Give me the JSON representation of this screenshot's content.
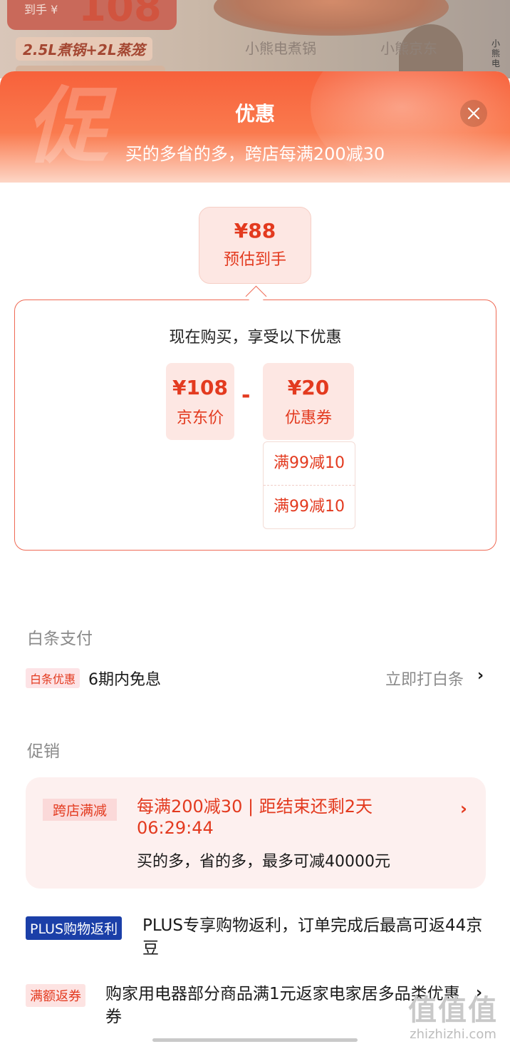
{
  "background_page": {
    "price_label": "到手 ¥",
    "price_value": "108",
    "feature": "2.5L煮锅+2L蒸笼",
    "tab_1": "小熊电煮锅",
    "tab_2": "小熊京东",
    "side_text": "小熊电"
  },
  "sheet": {
    "watermark_glyph": "促",
    "title": "优惠",
    "subtitle": "买的多省的多，跨店每满200减30"
  },
  "estimate": {
    "price": "¥88",
    "label": "预估到手"
  },
  "breakdown": {
    "title": "现在购买，享受以下优惠",
    "jd_price": "¥108",
    "jd_price_label": "京东价",
    "minus": "-",
    "coupon_value": "¥20",
    "coupon_label": "优惠券",
    "coupons": [
      "满99减10",
      "满99减10"
    ]
  },
  "baitiao": {
    "section_title": "白条支付",
    "tag": "白条优惠",
    "text": "6期内免息",
    "link": "立即打白条"
  },
  "promotion": {
    "section_title": "促销",
    "card": {
      "tag": "跨店满减",
      "main_line": "每满200减30 | 距结束还剩2天 06:29:44",
      "sub_line": "买的多，省的多，最多可减40000元"
    },
    "plus": {
      "tag": "PLUS购物返利",
      "text": "PLUS专享购物返利，订单完成后最高可返44京豆"
    },
    "return_coupon": {
      "tag": "满额返券",
      "text": "购家用电器部分商品满1元返家电家居多品类优惠券"
    }
  },
  "watermark": {
    "glyphs": "值值值",
    "url": "zhizhizhi.com"
  }
}
